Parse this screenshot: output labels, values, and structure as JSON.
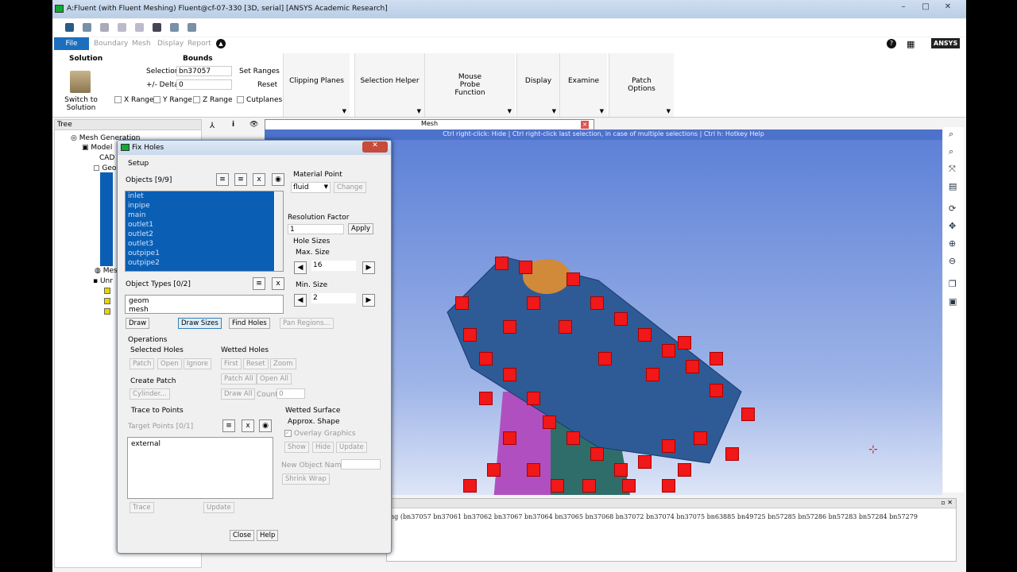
{
  "window": {
    "title": "A:Fluent (with Fluent Meshing) Fluent@cf-07-330  [3D, serial] [ANSYS Academic Research]",
    "brand": "ANSYS",
    "min": "–",
    "max": "□",
    "close": "✕"
  },
  "menu_tabs": [
    "File",
    "Boundary",
    "Mesh",
    "Display",
    "Report"
  ],
  "ribbon": {
    "solution_title": "Solution",
    "switch_label": "Switch to Solution",
    "bounds_title": "Bounds",
    "selection_label": "Selection",
    "selection_value": "bn37057",
    "delta_label": "+/- Delta",
    "delta_value": "0",
    "set_ranges": "Set Ranges",
    "reset": "Reset",
    "x_range": "X Range",
    "y_range": "Y Range",
    "z_range": "Z Range",
    "cutplanes": "Cutplanes",
    "groups": [
      "Clipping Planes",
      "Selection Helper",
      "Mouse Probe Function",
      "Display",
      "Examine",
      "Patch Options"
    ]
  },
  "tree": {
    "header": "Tree",
    "mesh_generation": "Mesh Generation",
    "model": "Model",
    "cad": "CAD",
    "geom": "Geo",
    "mesh": "Mes",
    "unref": "Unr"
  },
  "graphics": {
    "tab_title": "Mesh",
    "hint": "Ctrl right-click: Hide | Ctrl right-click last selection, in case of multiple selections | Ctrl h: Hotkey Help"
  },
  "console": {
    "text": "ng  (bn37057 bn37061 bn37062 bn37067 bn37064 bn37065 bn37068 bn37072 bn37074 bn37075 bn63885 bn49725 bn57285 bn57286 bn57283 bn57284 bn57279"
  },
  "dialog": {
    "title": "Fix Holes",
    "setup": "Setup",
    "objects_label": "Objects [9/9]",
    "objects": [
      "inlet",
      "inpipe",
      "main",
      "outlet1",
      "outlet2",
      "outlet3",
      "outpipe1",
      "outpipe2"
    ],
    "material_point_label": "Material Point",
    "material_point_value": "fluid",
    "change": "Change",
    "resolution_label": "Resolution Factor",
    "resolution_value": "1",
    "apply": "Apply",
    "hole_sizes": "Hole Sizes",
    "max_size_label": "Max. Size",
    "max_size_value": "16",
    "min_size_label": "Min. Size",
    "min_size_value": "2",
    "object_types_label": "Object Types [0/2]",
    "object_types": [
      "geom",
      "mesh"
    ],
    "draw": "Draw",
    "draw_sizes": "Draw Sizes",
    "find_holes": "Find Holes",
    "pan_regions": "Pan Regions...",
    "operations": "Operations",
    "selected_holes": "Selected Holes",
    "patch": "Patch",
    "open": "Open",
    "ignore": "Ignore",
    "wetted_holes": "Wetted Holes",
    "first": "First",
    "reset": "Reset",
    "zoom": "Zoom",
    "patch_all": "Patch All",
    "open_all": "Open All",
    "draw_all": "Draw All",
    "count_label": "Count",
    "count_value": "0",
    "create_patch": "Create Patch",
    "cylinder": "Cylinder...",
    "trace_to_points": "Trace to Points",
    "target_points": "Target Points [0/1]",
    "target_items": [
      "external"
    ],
    "trace": "Trace",
    "update": "Update",
    "wetted_surface": "Wetted Surface",
    "approx_shape": "Approx. Shape",
    "overlay_graphics": "Overlay Graphics",
    "show": "Show",
    "hide": "Hide",
    "update2": "Update",
    "new_object_name": "New Object Name",
    "shrink_wrap": "Shrink Wrap",
    "close": "Close",
    "help": "Help"
  }
}
